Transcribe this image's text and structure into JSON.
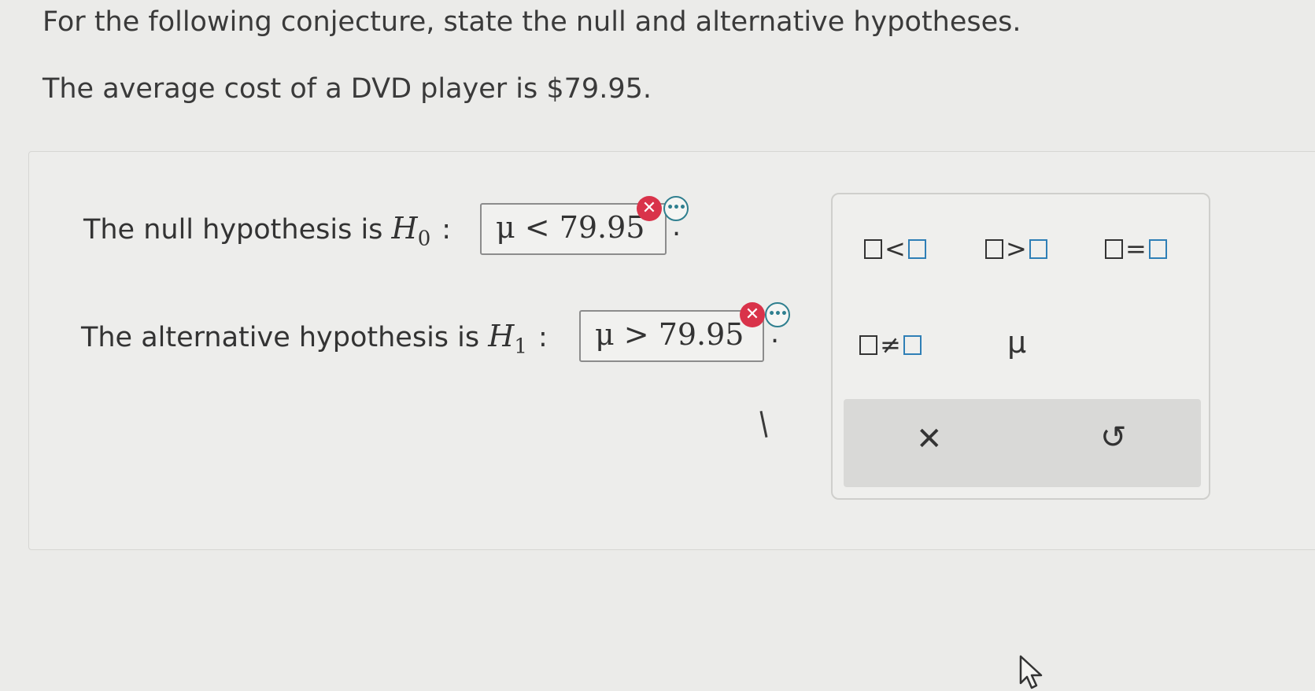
{
  "question": {
    "prompt": "For the following conjecture, state the null and alternative hypotheses.",
    "conjecture": "The average cost of a DVD player is $79.95."
  },
  "null_hypothesis": {
    "label": "The null hypothesis is",
    "symbol": "H",
    "subscript": "0",
    "colon": ":",
    "answer": "μ < 79.95",
    "period": ".",
    "status_icon": "error-x-icon"
  },
  "alternative_hypothesis": {
    "label": "The alternative hypothesis is",
    "symbol": "H",
    "subscript": "1",
    "colon": ":",
    "answer": "μ > 79.95",
    "period": ".",
    "status_icon": "error-x-icon"
  },
  "palette": {
    "templates": [
      {
        "name": "less-than",
        "operator": "<"
      },
      {
        "name": "greater-than",
        "operator": ">"
      },
      {
        "name": "equals",
        "operator": "="
      },
      {
        "name": "not-equal",
        "operator": "≠"
      }
    ],
    "mu_symbol": "μ",
    "clear_glyph": "✕",
    "undo_glyph": "↺"
  },
  "colors": {
    "error": "#d9334a",
    "accent": "#2f7f8f",
    "template_box": "#2f7fb6"
  }
}
